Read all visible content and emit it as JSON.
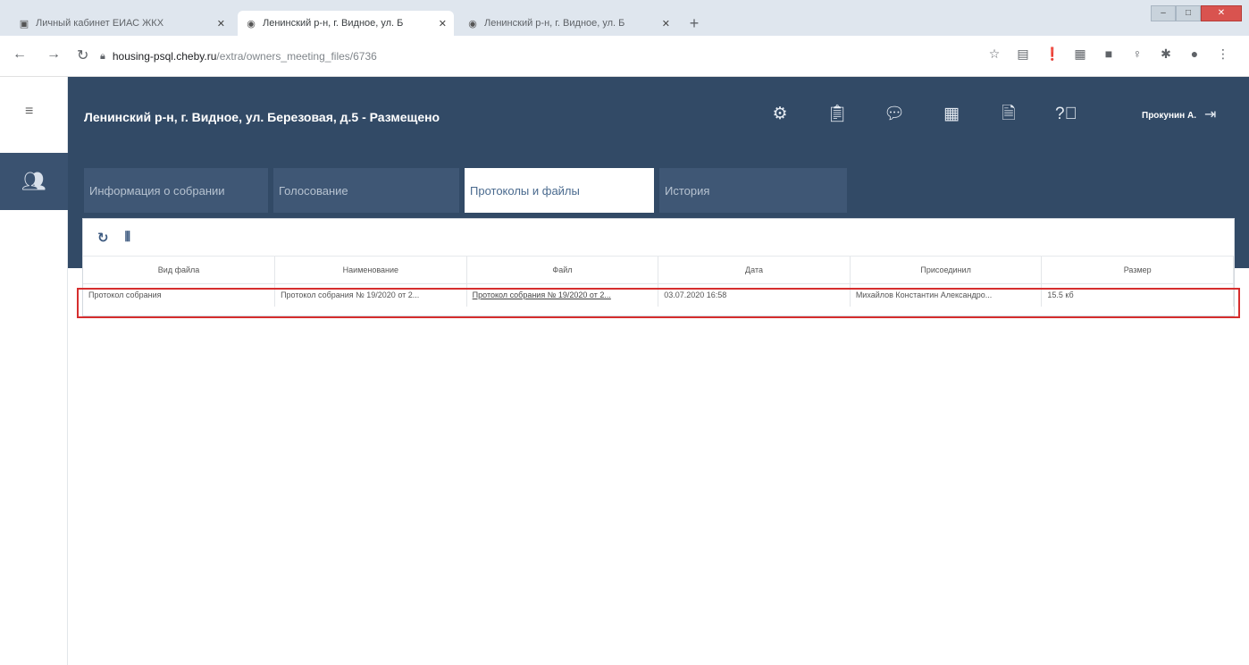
{
  "browser": {
    "tabs": [
      {
        "title": "Личный кабинет ЕИАС ЖКХ",
        "active": false
      },
      {
        "title": "Ленинский р-н, г. Видное, ул. Б",
        "active": true
      },
      {
        "title": "Ленинский р-н, г. Видное, ул. Б",
        "active": false
      }
    ],
    "url_host": "housing-psql.cheby.ru",
    "url_path": "/extra/owners_meeting_files/6736"
  },
  "header": {
    "title": "Ленинский р-н, г. Видное, ул. Березовая, д.5 - Размещено",
    "user": "Прокунин А.",
    "icons": [
      "gear-icon",
      "clipboard-edit-icon",
      "chat-icon",
      "calendar-icon",
      "document-icon",
      "help-icon"
    ]
  },
  "tabs": [
    {
      "label": "Информация о собрании",
      "active": false
    },
    {
      "label": "Голосование",
      "active": false
    },
    {
      "label": "Протоколы и файлы",
      "active": true
    },
    {
      "label": "История",
      "active": false
    }
  ],
  "table": {
    "columns": [
      "Вид файла",
      "Наименование",
      "Файл",
      "Дата",
      "Присоединил",
      "Размер"
    ],
    "rows": [
      {
        "type": "Протокол собрания",
        "name": "Протокол собрания № 19/2020 от 2...",
        "file": "Протокол собрания № 19/2020 от 2...",
        "date": "03.07.2020 16:58",
        "attached_by": "Михайлов Константин Александро...",
        "size": "15.5 кб"
      }
    ]
  },
  "colors": {
    "header_bg": "#324a66",
    "highlight": "#d62e2e"
  }
}
